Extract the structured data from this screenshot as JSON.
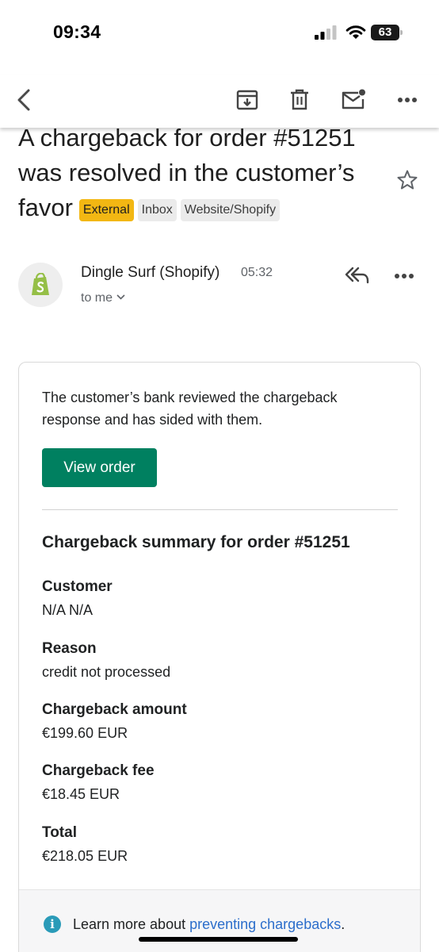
{
  "status_bar": {
    "time": "09:34",
    "battery": "63",
    "icons": [
      "cellular-signal-icon",
      "wifi-icon",
      "battery-icon"
    ]
  },
  "toolbar": {
    "icons": [
      "back-arrow-icon",
      "archive-icon",
      "trash-icon",
      "mark-unread-icon",
      "more-horizontal-icon"
    ]
  },
  "email": {
    "subject": "A chargeback for order #51251 was resolved in the customer’s favor",
    "labels": [
      "External",
      "Inbox",
      "Website/Shopify"
    ],
    "label_colors": {
      "External": "#f2b713",
      "default": "#ebebeb"
    },
    "sender": "Dingle Surf (Shopify)",
    "time": "05:32",
    "recipient": "to me"
  },
  "body": {
    "intro": "The customer’s bank reviewed the chargeback response and has sided with them.",
    "button_label": "View order",
    "button_color": "#008060",
    "summary_title": "Chargeback summary for order #51251",
    "fields": [
      {
        "label": "Customer",
        "value": "N/A N/A"
      },
      {
        "label": "Reason",
        "value": "credit not processed"
      },
      {
        "label": "Chargeback amount",
        "value": "€199.60 EUR"
      },
      {
        "label": "Chargeback fee",
        "value": "€18.45 EUR"
      },
      {
        "label": "Total",
        "value": "€218.05 EUR"
      }
    ],
    "footer": {
      "prefix": "Learn more about ",
      "link": "preventing chargebacks",
      "suffix": ".",
      "info_glyph": "i"
    }
  }
}
